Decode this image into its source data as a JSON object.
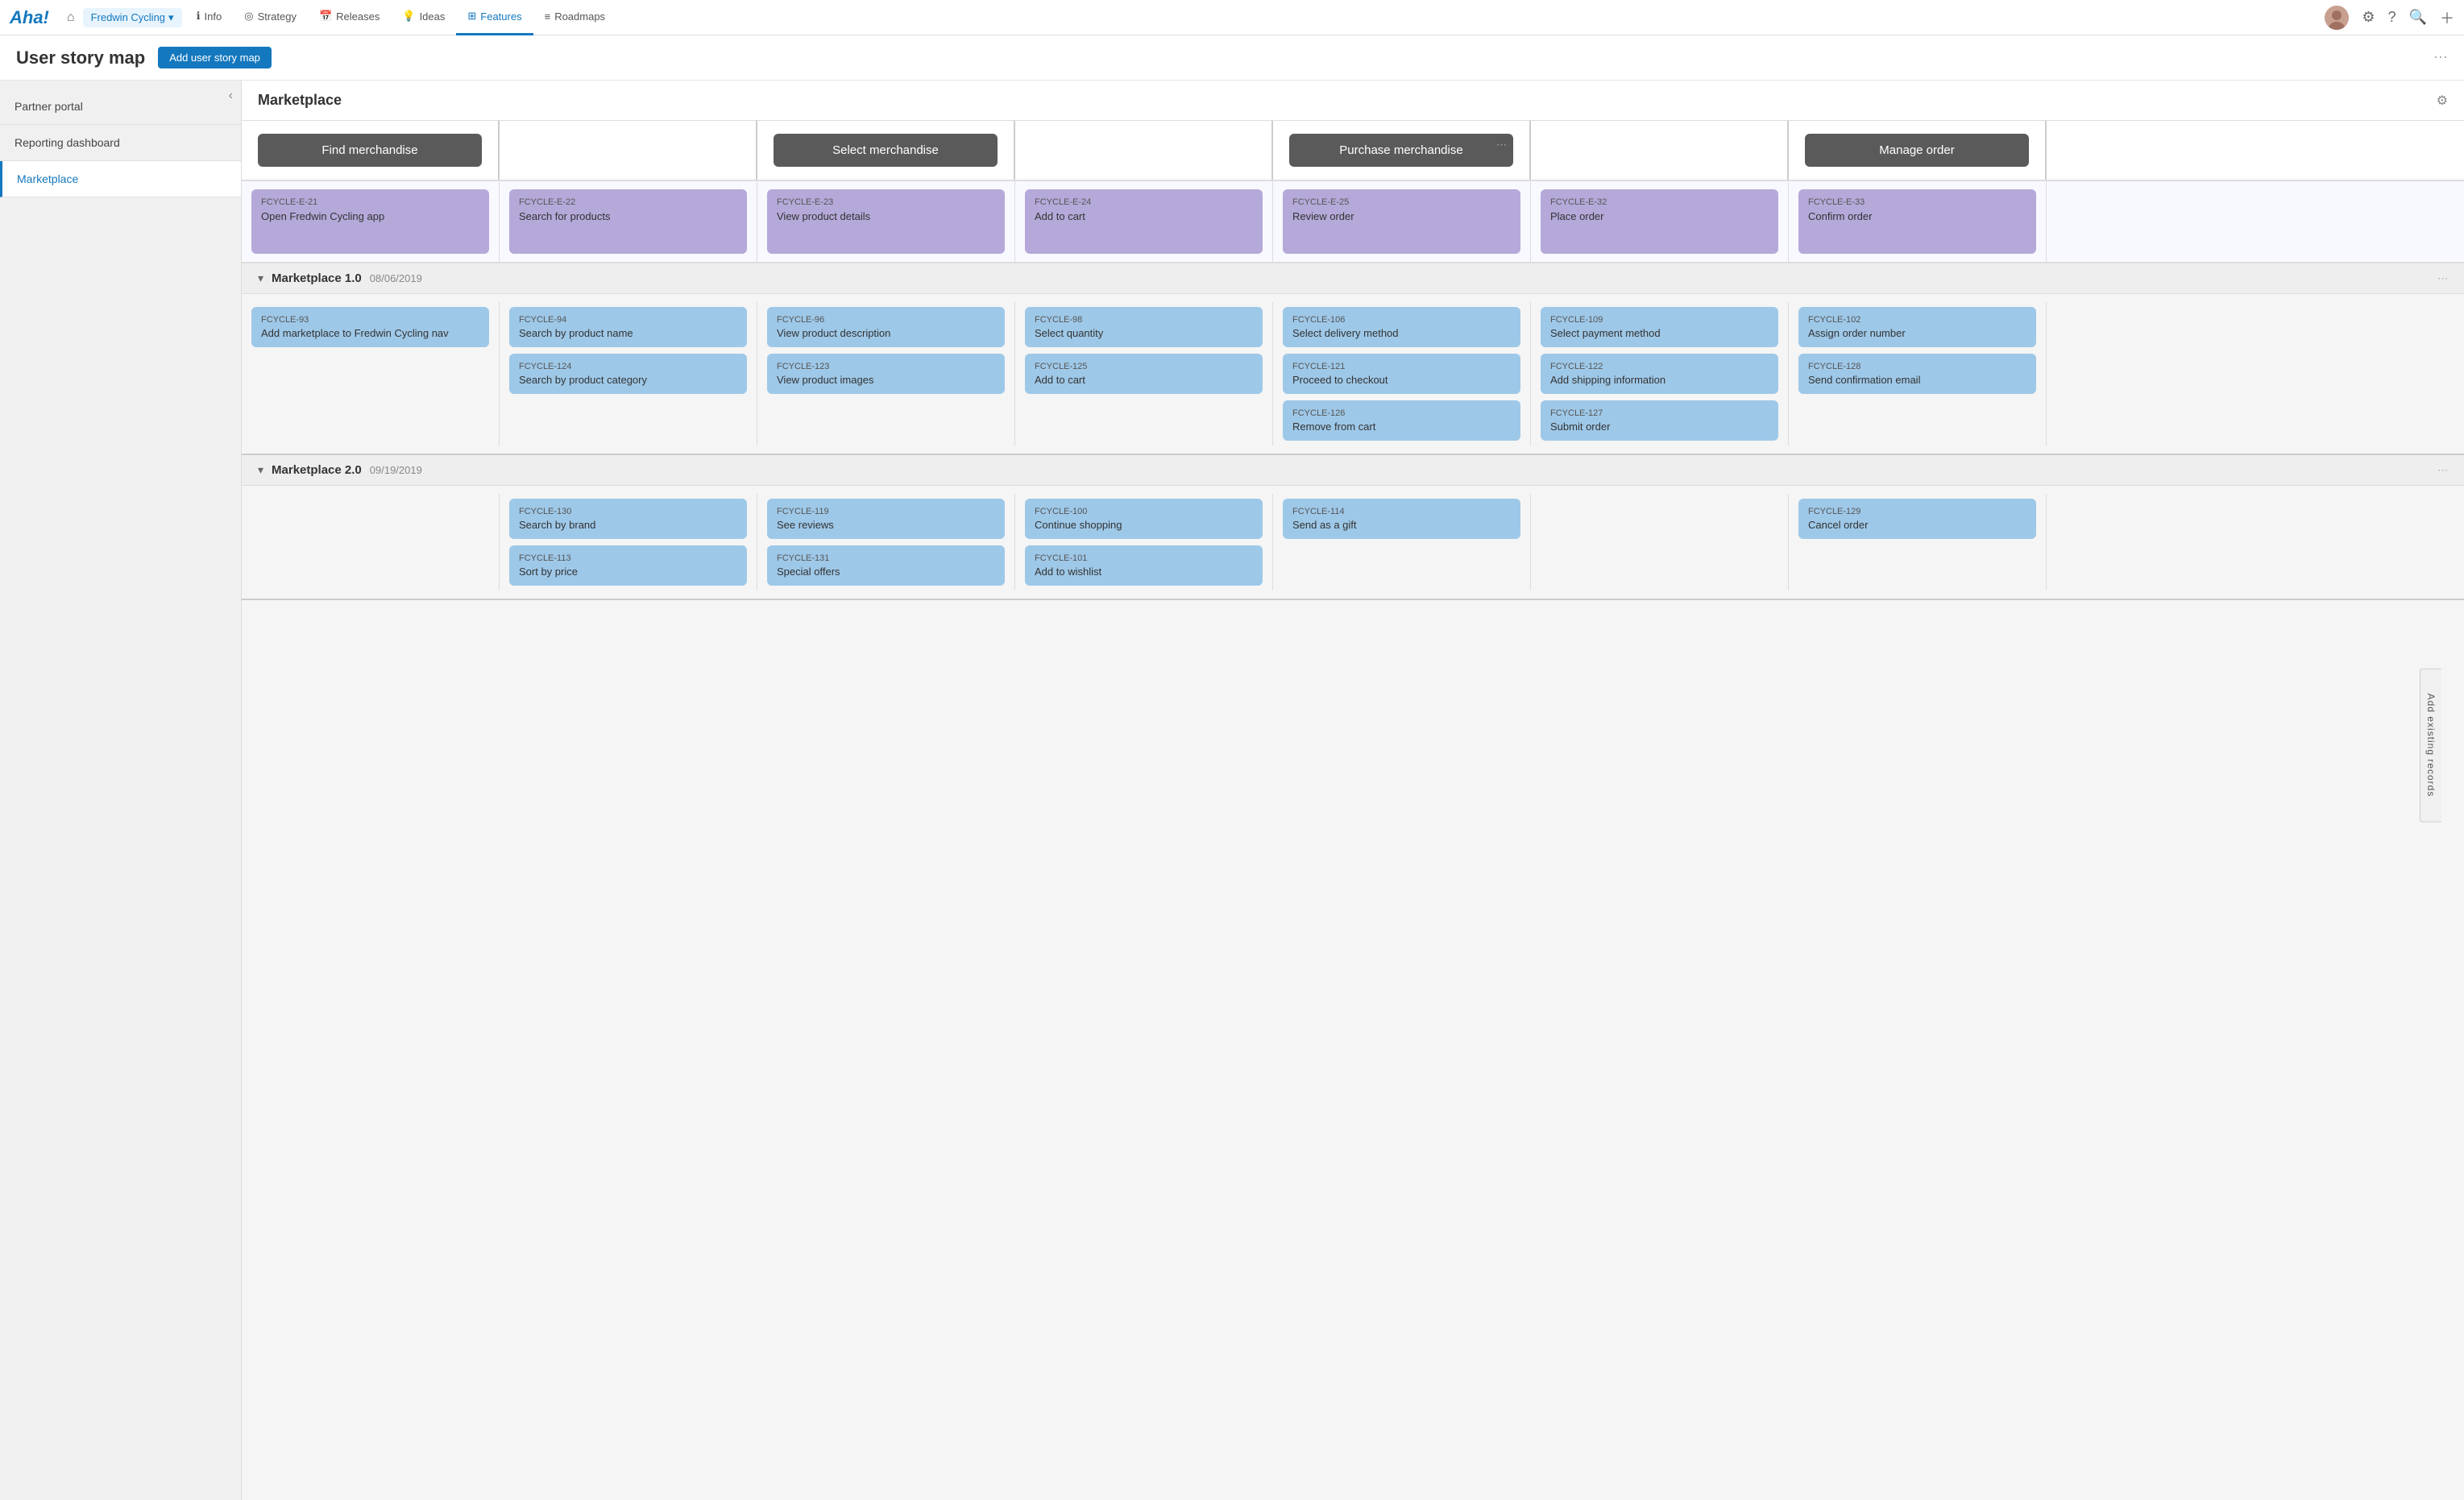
{
  "app": {
    "logo": "Aha!",
    "home_icon": "⌂",
    "product": "Fredwin Cycling",
    "nav_items": [
      {
        "label": "Info",
        "icon": "ℹ",
        "active": false
      },
      {
        "label": "Strategy",
        "icon": "◎",
        "active": false
      },
      {
        "label": "Releases",
        "icon": "📅",
        "active": false
      },
      {
        "label": "Ideas",
        "icon": "💡",
        "active": false
      },
      {
        "label": "Features",
        "icon": "⊞",
        "active": true
      },
      {
        "label": "Roadmaps",
        "icon": "≡",
        "active": false
      }
    ],
    "more_button": "⋯"
  },
  "page": {
    "title": "User story map",
    "add_button": "Add user story map"
  },
  "sidebar": {
    "items": [
      {
        "label": "Partner portal",
        "active": false
      },
      {
        "label": "Reporting dashboard",
        "active": false
      },
      {
        "label": "Marketplace",
        "active": true
      }
    ]
  },
  "story_map": {
    "title": "Marketplace",
    "add_existing": "Add existing records",
    "epics": [
      {
        "label": "Find merchandise",
        "span": 2
      },
      {
        "label": "Select merchandise",
        "span": 2
      },
      {
        "label": "Purchase merchandise",
        "span": 2,
        "has_more": true
      },
      {
        "label": "Manage order",
        "span": 2
      }
    ],
    "features": [
      {
        "id": "FCYCLE-E-21",
        "title": "Open Fredwin Cycling app"
      },
      {
        "id": "FCYCLE-E-22",
        "title": "Search for products"
      },
      {
        "id": "FCYCLE-E-23",
        "title": "View product details"
      },
      {
        "id": "FCYCLE-E-24",
        "title": "Add to cart"
      },
      {
        "id": "FCYCLE-E-25",
        "title": "Review order"
      },
      {
        "id": "FCYCLE-E-32",
        "title": "Place order"
      },
      {
        "id": "FCYCLE-E-33",
        "title": "Confirm order"
      }
    ],
    "releases": [
      {
        "name": "Marketplace 1.0",
        "date": "08/06/2019",
        "stories": [
          [
            {
              "id": "FCYCLE-93",
              "title": "Add marketplace to Fredwin Cycling nav"
            }
          ],
          [
            {
              "id": "FCYCLE-94",
              "title": "Search by product name"
            },
            {
              "id": "FCYCLE-124",
              "title": "Search by product category"
            }
          ],
          [
            {
              "id": "FCYCLE-96",
              "title": "View product description"
            },
            {
              "id": "FCYCLE-123",
              "title": "View product images"
            }
          ],
          [
            {
              "id": "FCYCLE-98",
              "title": "Select quantity"
            },
            {
              "id": "FCYCLE-125",
              "title": "Add to cart"
            }
          ],
          [
            {
              "id": "FCYCLE-106",
              "title": "Select delivery method"
            },
            {
              "id": "FCYCLE-121",
              "title": "Proceed to checkout"
            },
            {
              "id": "FCYCLE-126",
              "title": "Remove from cart"
            }
          ],
          [
            {
              "id": "FCYCLE-109",
              "title": "Select payment method"
            },
            {
              "id": "FCYCLE-122",
              "title": "Add shipping information"
            },
            {
              "id": "FCYCLE-127",
              "title": "Submit order"
            }
          ],
          [
            {
              "id": "FCYCLE-102",
              "title": "Assign order number"
            },
            {
              "id": "FCYCLE-128",
              "title": "Send confirmation email"
            }
          ]
        ]
      },
      {
        "name": "Marketplace 2.0",
        "date": "09/19/2019",
        "stories": [
          [],
          [
            {
              "id": "FCYCLE-130",
              "title": "Search by brand"
            },
            {
              "id": "FCYCLE-113",
              "title": "Sort by price"
            }
          ],
          [
            {
              "id": "FCYCLE-119",
              "title": "See reviews"
            },
            {
              "id": "FCYCLE-131",
              "title": "Special offers"
            }
          ],
          [
            {
              "id": "FCYCLE-100",
              "title": "Continue shopping"
            },
            {
              "id": "FCYCLE-101",
              "title": "Add to wishlist"
            }
          ],
          [
            {
              "id": "FCYCLE-114",
              "title": "Send as a gift"
            }
          ],
          [],
          [
            {
              "id": "FCYCLE-129",
              "title": "Cancel order"
            }
          ]
        ]
      }
    ]
  }
}
